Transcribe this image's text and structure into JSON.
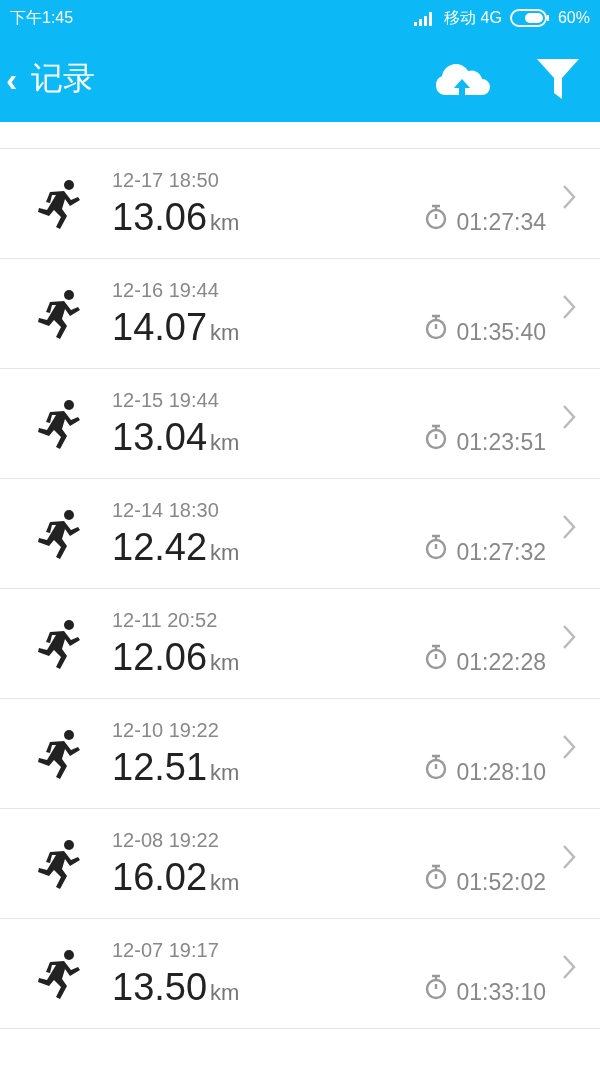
{
  "status_bar": {
    "time": "下午1:45",
    "carrier": "移动 4G",
    "battery": "60%"
  },
  "header": {
    "back": "‹",
    "title": "记录"
  },
  "records": [
    {
      "date": "12-17 18:50",
      "distance": "13.06",
      "unit": "km",
      "duration": "01:27:34"
    },
    {
      "date": "12-16 19:44",
      "distance": "14.07",
      "unit": "km",
      "duration": "01:35:40"
    },
    {
      "date": "12-15 19:44",
      "distance": "13.04",
      "unit": "km",
      "duration": "01:23:51"
    },
    {
      "date": "12-14 18:30",
      "distance": "12.42",
      "unit": "km",
      "duration": "01:27:32"
    },
    {
      "date": "12-11 20:52",
      "distance": "12.06",
      "unit": "km",
      "duration": "01:22:28"
    },
    {
      "date": "12-10 19:22",
      "distance": "12.51",
      "unit": "km",
      "duration": "01:28:10"
    },
    {
      "date": "12-08 19:22",
      "distance": "16.02",
      "unit": "km",
      "duration": "01:52:02"
    },
    {
      "date": "12-07 19:17",
      "distance": "13.50",
      "unit": "km",
      "duration": "01:33:10"
    }
  ]
}
